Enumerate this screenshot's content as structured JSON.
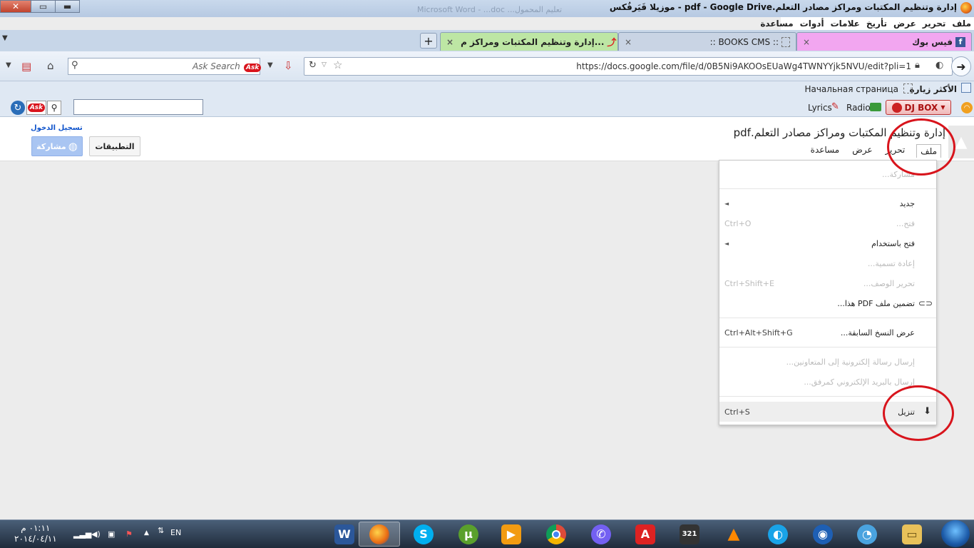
{
  "window": {
    "title": "إدارة وتنظيم المكتبات ومراكز مصادر التعلم.pdf - Google Drive - موزيلا فَيَرفُكس",
    "ghost_title": "Microsoft Word - ...doc   ...تعليم المحمول",
    "buttons": [
      "close",
      "maximize",
      "minimize"
    ]
  },
  "menubar": [
    "ملف",
    "تحرير",
    "عرض",
    "تأريخ",
    "علامات",
    "أدوات",
    "مساعدة"
  ],
  "tabs": [
    {
      "label": "فيس بوك",
      "icon": "facebook-icon",
      "close": "×"
    },
    {
      "label": ":: BOOKS CMS ::",
      "icon": "page-icon",
      "close": "×"
    },
    {
      "label": "إدارة وتنظيم المكتبات ومراكز م...",
      "icon": "pdf-icon",
      "close": "×"
    }
  ],
  "new_tab_label": "+",
  "navbar": {
    "url": "https://docs.google.com/file/d/0B5Ni9AKOOsEUaWg4TWNYYjk5NVU/edit?pli=1",
    "search_placeholder": "Ask Search",
    "ask_logo": "Ask"
  },
  "bookmarks": {
    "most_visited": "الأكثر زيارة",
    "home": "Начальная страница"
  },
  "toolbar": {
    "ask_logo": "Ask",
    "lyrics": "Lyrics",
    "radio": "Radio",
    "djbox": "DJ BOX"
  },
  "doc": {
    "title": "إدارة وتنظيم المكتبات ومراكز مصادر التعلم.pdf",
    "menu": [
      "ملف",
      "تحرير",
      "عرض",
      "مساعدة"
    ],
    "login": "تسجيل الدخول",
    "share": "مشاركة",
    "apps": "التطبيقات"
  },
  "file_menu": {
    "share": "مشاركة...",
    "new": "جديد",
    "open": "فتح...",
    "open_shortcut": "Ctrl+O",
    "open_with": "فتح باستخدام",
    "rename": "إعادة تسمية...",
    "edit_desc": "تحرير الوصف...",
    "edit_desc_shortcut": "Ctrl+Shift+E",
    "embed": "تضمين ملف PDF هذا...",
    "revisions": "عرض النسخ السابقة...",
    "revisions_shortcut": "Ctrl+Alt+Shift+G",
    "email_collab": "إرسال رسالة إلكترونية إلى المتعاونين...",
    "email_attach": "إرسال بالبريد الإلكتروني كمرفق...",
    "download": "تنزيل",
    "download_shortcut": "Ctrl+S",
    "submenu_arrow": "◄"
  },
  "taskbar": {
    "time": "٠١:١١ م",
    "date": "٢٠١٤/٠٤/١١",
    "lang": "EN",
    "apps": [
      {
        "name": "word-icon",
        "glyph": "W",
        "color": "#2b579a"
      },
      {
        "name": "firefox-icon",
        "glyph": "",
        "color": "#e66000"
      },
      {
        "name": "skype-icon",
        "glyph": "S",
        "color": "#00aff0"
      },
      {
        "name": "utorrent-icon",
        "glyph": "µ",
        "color": "#5aa02c"
      },
      {
        "name": "video-icon",
        "glyph": "▶",
        "color": "#f29b11"
      },
      {
        "name": "chrome-icon",
        "glyph": "",
        "color": "#dd4b39"
      },
      {
        "name": "viber-icon",
        "glyph": "✆",
        "color": "#7360f2"
      },
      {
        "name": "acrobat-icon",
        "glyph": "A",
        "color": "#d22"
      },
      {
        "name": "media-player-321-icon",
        "glyph": "321",
        "color": "#333"
      },
      {
        "name": "vlc-icon",
        "glyph": "▲",
        "color": "#f80"
      },
      {
        "name": "update-icon",
        "glyph": "◐",
        "color": "#19a3e8"
      },
      {
        "name": "earth-icon",
        "glyph": "◉",
        "color": "#1e5fb4"
      },
      {
        "name": "app-icon",
        "glyph": "◔",
        "color": "#4aa3df"
      },
      {
        "name": "folder-icon",
        "glyph": "▭",
        "color": "#e8c15a"
      }
    ]
  }
}
